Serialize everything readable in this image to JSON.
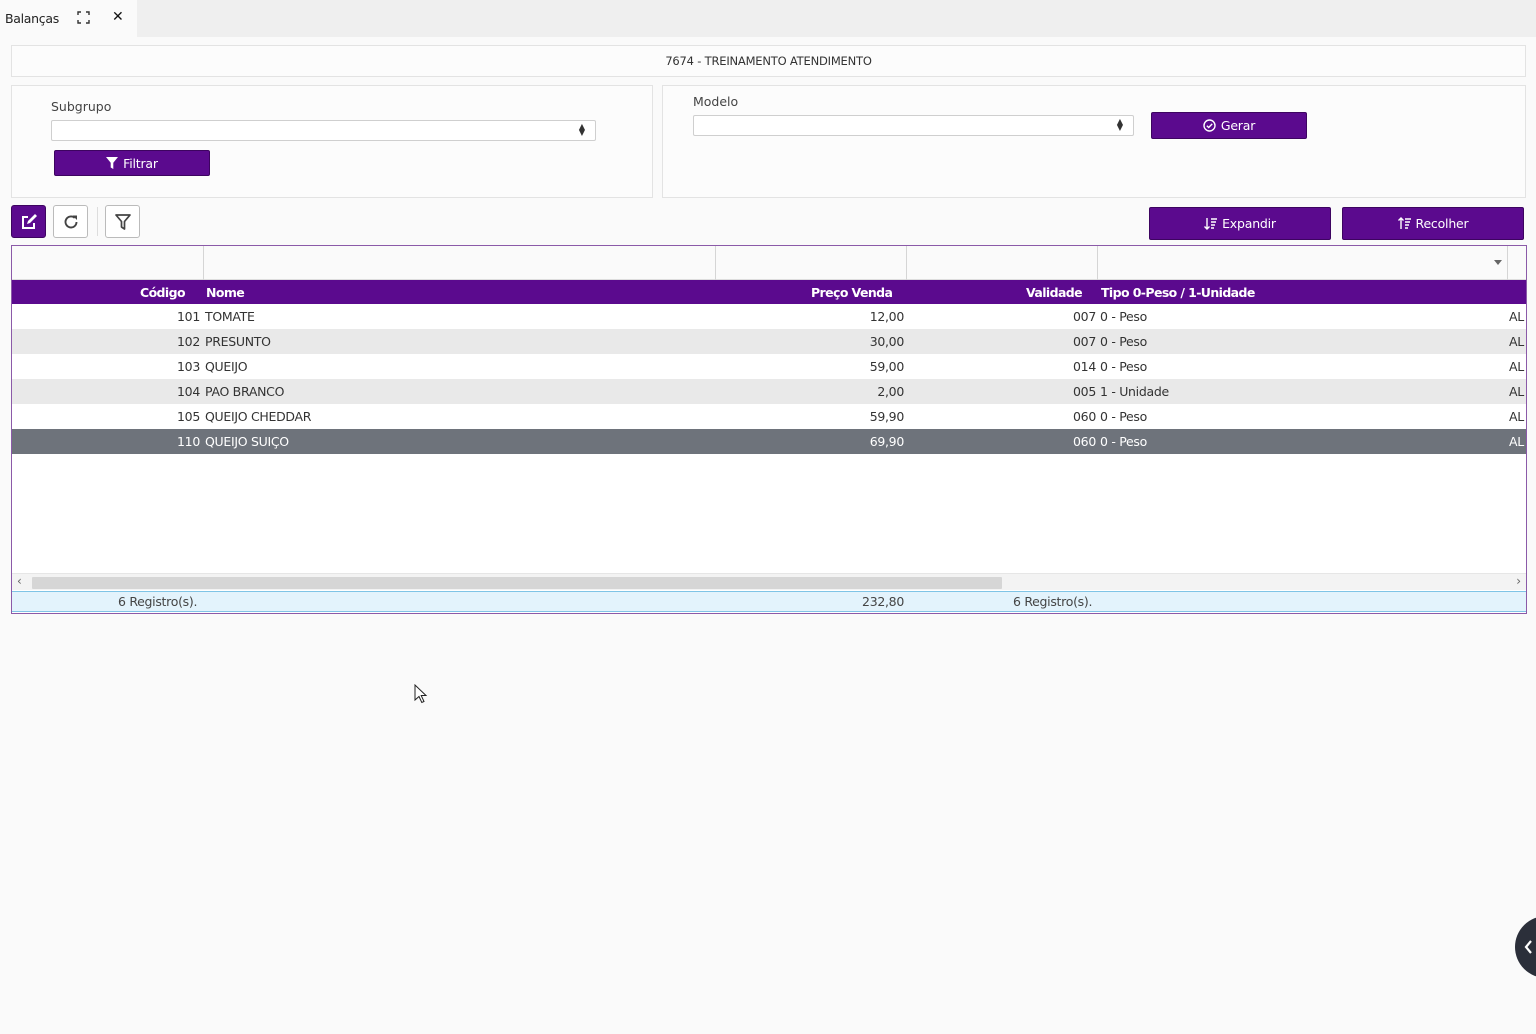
{
  "tab": {
    "title": "Balanças",
    "close": "✕"
  },
  "company": {
    "name": "7674 - TREINAMENTO ATENDIMENTO"
  },
  "filters": {
    "subgrupo_label": "Subgrupo",
    "subgrupo_value": "",
    "filtrar_label": "Filtrar",
    "modelo_label": "Modelo",
    "modelo_value": "",
    "gerar_label": "Gerar"
  },
  "toolbar": {
    "expandir_label": "Expandir",
    "recolher_label": "Recolher"
  },
  "table": {
    "columns": {
      "codigo": "Código",
      "nome": "Nome",
      "preco": "Preço Venda",
      "validade": "Validade",
      "tipo": "Tipo 0-Peso / 1-Unidade"
    },
    "rows": [
      {
        "codigo": "101",
        "nome": "TOMATE",
        "preco": "12,00",
        "validade": "007",
        "tipo": "0 - Peso",
        "extra": "AL"
      },
      {
        "codigo": "102",
        "nome": "PRESUNTO",
        "preco": "30,00",
        "validade": "007",
        "tipo": "0 - Peso",
        "extra": "AL"
      },
      {
        "codigo": "103",
        "nome": "QUEIJO",
        "preco": "59,00",
        "validade": "014",
        "tipo": "0 - Peso",
        "extra": "AL"
      },
      {
        "codigo": "104",
        "nome": "PAO BRANCO",
        "preco": "2,00",
        "validade": "005",
        "tipo": "1 - Unidade",
        "extra": "AL"
      },
      {
        "codigo": "105",
        "nome": "QUEIJO CHEDDAR",
        "preco": "59,90",
        "validade": "060",
        "tipo": "0 - Peso",
        "extra": "AL"
      },
      {
        "codigo": "110",
        "nome": "QUEIJO SUIÇO",
        "preco": "69,90",
        "validade": "060",
        "tipo": "0 - Peso",
        "extra": "AL"
      }
    ],
    "footer": {
      "count_left": "6 Registro(s).",
      "total_preco": "232,80",
      "count_right": "6 Registro(s)."
    }
  }
}
